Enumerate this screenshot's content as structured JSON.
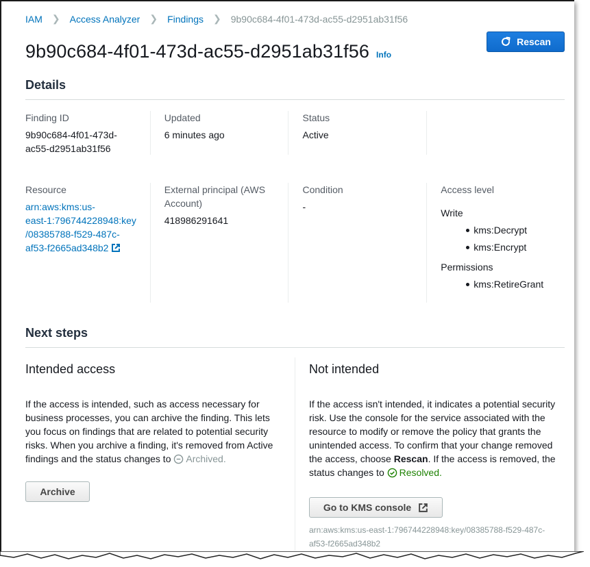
{
  "breadcrumb": {
    "items": [
      "IAM",
      "Access Analyzer",
      "Findings"
    ],
    "current": "9b90c684-4f01-473d-ac55-d2951ab31f56"
  },
  "header": {
    "title": "9b90c684-4f01-473d-ac55-d2951ab31f56",
    "info_label": "Info",
    "rescan_label": "Rescan",
    "rescan_icon": "refresh-icon"
  },
  "details": {
    "heading": "Details",
    "finding_id": {
      "label": "Finding ID",
      "value_line1": "9b90c684-4f01-473d-",
      "value_line2": "ac55-d2951ab31f56"
    },
    "updated": {
      "label": "Updated",
      "value": "6 minutes ago"
    },
    "status": {
      "label": "Status",
      "value": "Active"
    },
    "resource": {
      "label": "Resource",
      "lines": [
        "arn:aws:kms:us-",
        "east-1:796744228948:key",
        "/08385788-f529-487c-",
        "af53-f2665ad348b2"
      ],
      "icon": "external-link-icon"
    },
    "external_principal": {
      "label_line1": "External principal (AWS",
      "label_line2": "Account)",
      "value": "418986291641"
    },
    "condition": {
      "label": "Condition",
      "value": "-"
    },
    "access_level": {
      "label": "Access level",
      "groups": [
        {
          "name": "Write",
          "actions": [
            "kms:Decrypt",
            "kms:Encrypt"
          ]
        },
        {
          "name": "Permissions",
          "actions": [
            "kms:RetireGrant"
          ]
        }
      ]
    }
  },
  "next_steps": {
    "heading": "Next steps",
    "intended": {
      "title": "Intended access",
      "text": "If the access is intended, such as access necessary for business processes, you can archive the finding. This lets you focus on findings that are related to potential security risks. When you archive a finding, it's removed from Active findings and the status changes to",
      "status_label": "Archived.",
      "status_icon": "minus-circle-icon",
      "button_label": "Archive"
    },
    "not_intended": {
      "title": "Not intended",
      "text_before": "If the access isn't intended, it indicates a potential security risk. Use the console for the service associated with the resource to modify or remove the policy that grants the unintended access. To confirm that your change removed the access, choose",
      "bold_word": "Rescan",
      "text_after": ". If the access is removed, the status changes to",
      "status_label": "Resolved.",
      "status_icon": "check-circle-icon",
      "button_label": "Go to KMS console",
      "button_icon": "external-link-icon",
      "arn_caption": "arn:aws:kms:us-east-1:796744228948:key/08385788-f529-487c-af53-f2665ad348b2"
    }
  },
  "colors": {
    "link": "#0073bb",
    "primary_button": "#0f6bcc",
    "resolved": "#1d8102",
    "archived": "#879596"
  }
}
